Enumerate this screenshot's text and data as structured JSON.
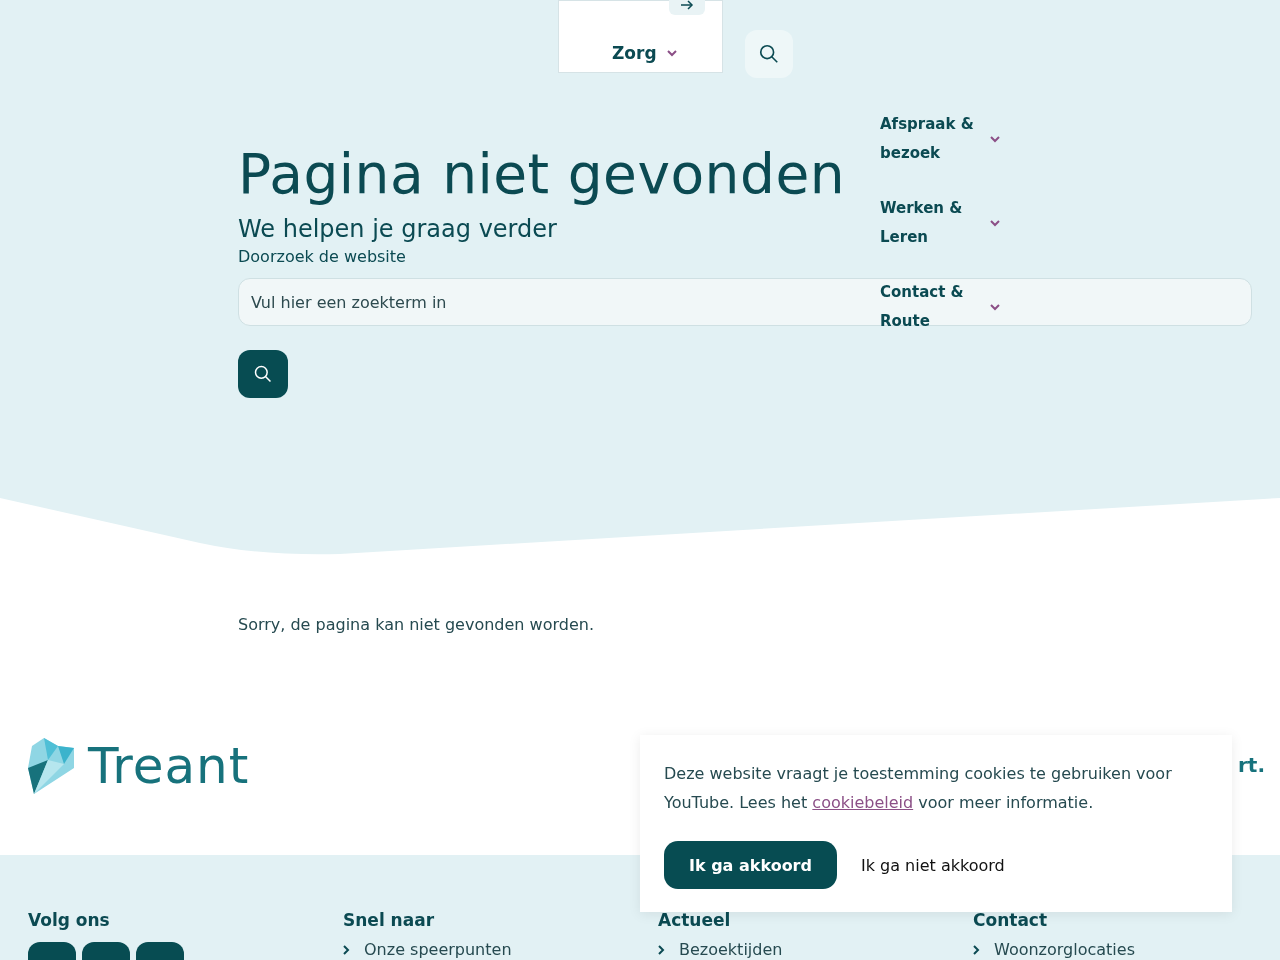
{
  "main_nav": [
    {
      "label": "Zorg",
      "expanded": false
    }
  ],
  "dropdown_nav": [
    {
      "label": "Afspraak & bezoek"
    },
    {
      "label": "Werken & Leren"
    },
    {
      "label": "Contact & Route"
    }
  ],
  "hero": {
    "title": "Pagina niet gevonden",
    "subtitle": "We helpen je graag verder",
    "search_label": "Doorzoek de website",
    "search_placeholder": "Vul hier een zoekterm in"
  },
  "message": "Sorry, de pagina kan niet gevonden worden.",
  "logo": {
    "text": "Treant"
  },
  "partial_text": "rt.",
  "footer": {
    "social_heading": "Volg ons",
    "columns": [
      {
        "heading": "Snel naar",
        "links": [
          "Onze speerpunten"
        ]
      },
      {
        "heading": "Actueel",
        "links": [
          "Bezoektijden"
        ]
      },
      {
        "heading": "Contact",
        "links": [
          "Woonzorglocaties"
        ]
      }
    ]
  },
  "cookie": {
    "text_before": "Deze website vraagt je toestemming cookies te gebruiken voor YouTube. Lees het ",
    "link": "cookiebeleid",
    "text_after": " voor meer informatie.",
    "accept": "Ik ga akkoord",
    "decline": "Ik ga niet akkoord"
  }
}
